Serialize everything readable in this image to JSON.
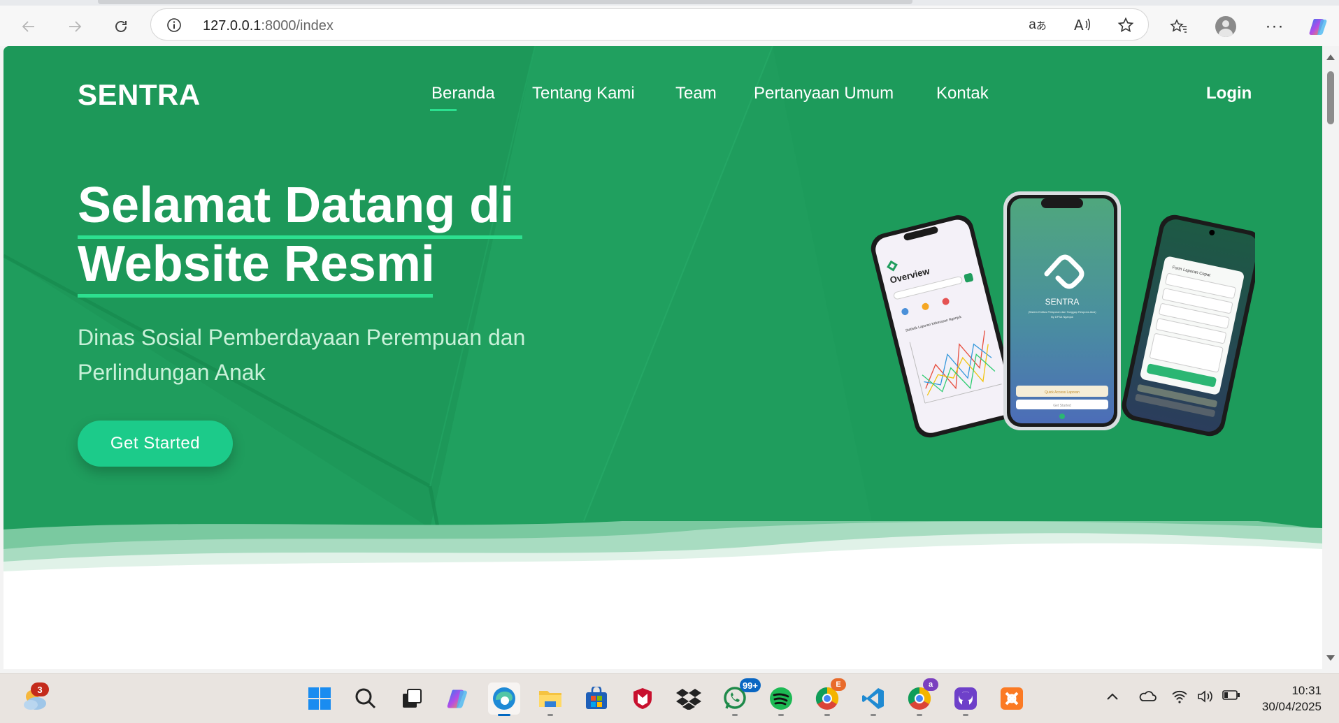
{
  "browser": {
    "url_host": "127.0.0.1",
    "url_path": ":8000/index",
    "icons": [
      "back-arrow-icon",
      "forward-arrow-icon",
      "refresh-icon",
      "info-icon",
      "translate-icon",
      "read-aloud-icon",
      "star-icon",
      "favorites-icon",
      "profile-avatar-icon",
      "more-icon",
      "copilot-icon"
    ]
  },
  "site": {
    "brand": "SENTRA",
    "nav": [
      "Beranda",
      "Tentang Kami",
      "Team",
      "Pertanyaan Umum",
      "Kontak"
    ],
    "active_nav": "Beranda",
    "login": "Login"
  },
  "hero": {
    "title_line1": "Selamat Datang di",
    "title_line2": "Website Resmi",
    "subtitle": "Dinas Sosial Pemberdayaan Perempuan dan Perlindungan Anak",
    "cta": "Get Started"
  },
  "mockup": {
    "center_app_name": "SENTRA",
    "center_tagline": "(Sistem Entitas Pelaporan dan Tanggap Respons Aksi)",
    "center_by": "By DP3A Nganjuk",
    "center_btn1": "Quick Access Laporan",
    "center_btn2": "Get Started",
    "left_title": "Overview",
    "left_chart_title": "Statistik Laporan Kekerasan Nganjuk",
    "right_form_title": "Form Laporan Cepat",
    "right_fields": [
      "NIK",
      "Nama Lengkap",
      "Nomor Telepon",
      "Alamat",
      "Deskripsi Kasus"
    ],
    "right_submit": "Submit"
  },
  "taskbar": {
    "weather_badge": "3",
    "whatsapp_badge": "99+",
    "time": "10:31",
    "date": "30/04/2025"
  },
  "colors": {
    "hero_green": "#1f9d5d",
    "accent_green": "#1ccb8a",
    "underline": "#2de08f"
  }
}
